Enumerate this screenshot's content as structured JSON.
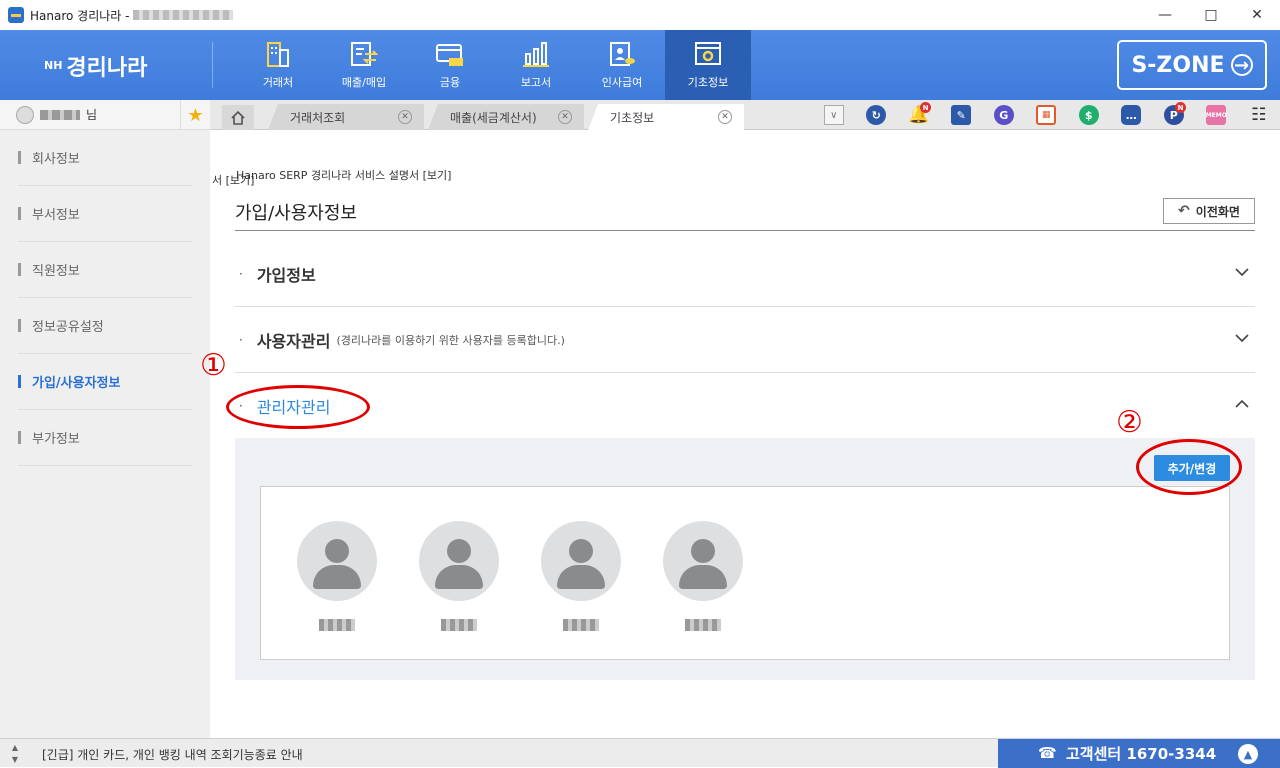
{
  "window": {
    "title": "Hanaro 경리나라 -",
    "controls": [
      "minimize",
      "maximize",
      "close"
    ]
  },
  "brand": {
    "prefix": "NH",
    "name": "경리나라"
  },
  "topnav": {
    "items": [
      {
        "label": "거래처",
        "icon": "building-icon"
      },
      {
        "label": "매출/매입",
        "icon": "exchange-icon"
      },
      {
        "label": "금융",
        "icon": "card-icon"
      },
      {
        "label": "보고서",
        "icon": "bar-chart-icon"
      },
      {
        "label": "인사급여",
        "icon": "person-coin-icon"
      },
      {
        "label": "기초정보",
        "icon": "gear-window-icon"
      }
    ],
    "active_index": 5,
    "szone_label": "S-ZONE"
  },
  "sidebar": {
    "user_suffix": "님",
    "items": [
      {
        "label": "회사정보"
      },
      {
        "label": "부서정보"
      },
      {
        "label": "직원정보"
      },
      {
        "label": "정보공유설정"
      },
      {
        "label": "가입/사용자정보"
      },
      {
        "label": "부가정보"
      }
    ],
    "active_index": 4
  },
  "tabs": {
    "items": [
      {
        "label": "거래처조회"
      },
      {
        "label": "매출(세금계산서)"
      },
      {
        "label": "기초정보"
      }
    ],
    "active_index": 2,
    "toolbar_icons": [
      "dropdown-icon",
      "refresh-icon",
      "bell-icon",
      "edit-icon",
      "g-icon",
      "calendar-icon",
      "dollar-icon",
      "chat-icon",
      "p-icon",
      "memo-icon",
      "grid-icon"
    ],
    "notification_badge": "N"
  },
  "main": {
    "manual_link": "Hanaro SERP 경리나라 서비스 설명서 [보기]",
    "manual_ghost": "서 [보기]",
    "page_title": "가입/사용자정보",
    "back_button": "이전화면",
    "sections": [
      {
        "label": "가입정보",
        "sub": "",
        "expanded": false
      },
      {
        "label": "사용자관리",
        "sub": "(경리나라를 이용하기 위한 사용자를 등록합니다.)",
        "expanded": false
      },
      {
        "label": "관리자관리",
        "sub": "",
        "expanded": true
      }
    ],
    "add_button": "추가/변경",
    "admin_count": 4
  },
  "annotations": {
    "marker_1": "①",
    "marker_2": "②",
    "color": "#e00000"
  },
  "statusbar": {
    "notice": "[긴급] 개인 카드, 개인 뱅킹 내역 조회기능종료 안내",
    "cs_label": "고객센터 1670-3344"
  },
  "colors": {
    "nav_blue": "#4a86e8",
    "active_nav": "#2a5fb4",
    "accent_blue": "#2d8be0",
    "cs_bar": "#3c6fc8"
  }
}
